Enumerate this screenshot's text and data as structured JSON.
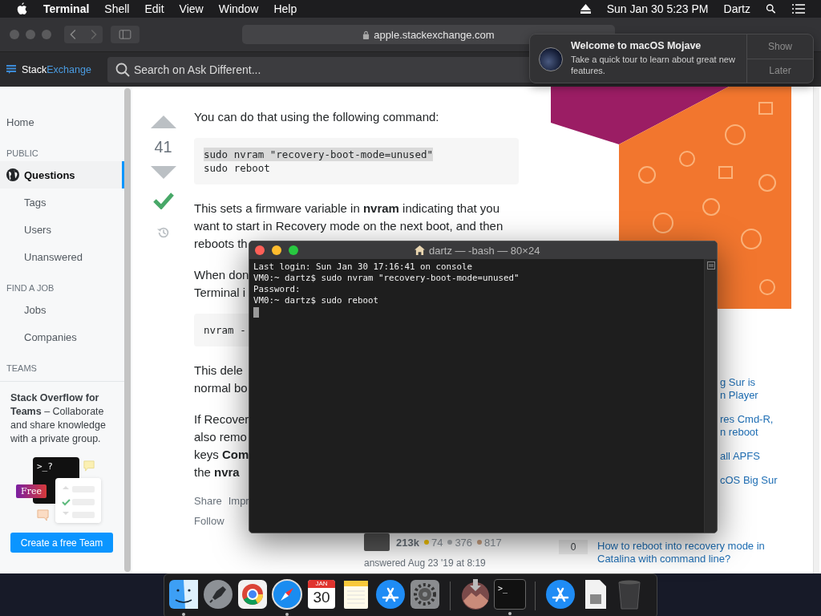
{
  "menu_bar": {
    "app": "Terminal",
    "menus": [
      "Shell",
      "Edit",
      "View",
      "Window",
      "Help"
    ],
    "clock": "Sun Jan 30  5:23 PM",
    "user": "Dartz"
  },
  "browser": {
    "url": "apple.stackexchange.com"
  },
  "site_header": {
    "logo": [
      "Stack",
      "Exchange"
    ],
    "search": {
      "placeholder": "Search on Ask Different..."
    }
  },
  "sidebar": {
    "items": [
      {
        "kind": "top",
        "label": "Home",
        "selected": false
      },
      {
        "kind": "section",
        "label": "PUBLIC"
      },
      {
        "kind": "top",
        "label": "Questions",
        "selected": true
      },
      {
        "kind": "sub",
        "label": "Tags",
        "selected": false
      },
      {
        "kind": "sub",
        "label": "Users",
        "selected": false
      },
      {
        "kind": "sub",
        "label": "Unanswered",
        "selected": false
      },
      {
        "kind": "section",
        "label": "FIND A JOB"
      },
      {
        "kind": "sub",
        "label": "Jobs",
        "selected": false
      },
      {
        "kind": "sub",
        "label": "Companies",
        "selected": false
      },
      {
        "kind": "section",
        "label": "TEAMS"
      }
    ],
    "teams": {
      "text": "**Stack Overflow for Teams** – Collaborate and share knowledge with a private group.",
      "prompt": ">_?",
      "badge": "Free",
      "button": "Create a free Team"
    }
  },
  "answer": {
    "votes": "41",
    "accepted": true,
    "blocks": [
      {
        "kind": "text",
        "lines": [
          "You can do that using the following command:"
        ]
      },
      {
        "kind": "code",
        "lines": [
          {
            "text": "sudo nvram \"recovery-boot-mode=unused\"",
            "selected": true
          },
          {
            "text": "sudo reboot",
            "selected": false
          }
        ]
      },
      {
        "kind": "text",
        "lines": [
          "This sets a firmware variable in **nvram** indicating that you",
          "want to start in Recovery mode on the next boot, and then",
          "reboots th"
        ]
      },
      {
        "kind": "text",
        "lines": [
          "When don",
          "Terminal i"
        ]
      },
      {
        "kind": "code",
        "lines": [
          {
            "text": "nvram -",
            "selected": false
          }
        ]
      },
      {
        "kind": "text",
        "lines": [
          "This dele",
          "normal bo"
        ]
      },
      {
        "kind": "text",
        "lines": [
          "If Recover",
          "also remo",
          "keys **Com**",
          "the **nvra**"
        ]
      }
    ],
    "actions": [
      "Share",
      "Impr"
    ],
    "follow": "Follow",
    "user": {
      "reputation": "213k",
      "gold": "74",
      "silver": "376",
      "bronze": "817"
    },
    "answered": "answered Aug 23 '19 at 8:19"
  },
  "related": [
    {
      "lines": [
        "g Sur is",
        "n Player"
      ]
    },
    {
      "lines": [
        "res Cmd-R,",
        "n reboot"
      ]
    },
    {
      "lines": [
        "all APFS"
      ]
    },
    {
      "lines": [
        "cOS Big Sur"
      ]
    },
    {
      "votes": "0",
      "lines": [
        "How to reboot into recovery mode in",
        "Catalina with command line?"
      ]
    }
  ],
  "terminal": {
    "title": "dartz — -bash — 80×24",
    "lines": [
      "Last login: Sun Jan 30 17:16:41 on console",
      "VM0:~ dartz$ sudo nvram \"recovery-boot-mode=unused\"",
      "Password:",
      "VM0:~ dartz$ sudo reboot"
    ]
  },
  "notification": {
    "title": "Welcome to macOS Mojave",
    "body": "Take a quick tour to learn about great new features.",
    "actions": [
      "Show",
      "Later"
    ]
  },
  "dock": [
    {
      "kind": "finder",
      "running": true
    },
    {
      "kind": "rocket",
      "running": false
    },
    {
      "kind": "ring",
      "running": false
    },
    {
      "kind": "compass",
      "running": true
    },
    {
      "kind": "calendar",
      "month": "JAN",
      "day": "30",
      "running": false
    },
    {
      "kind": "notes",
      "running": false
    },
    {
      "kind": "appstore",
      "running": false
    },
    {
      "kind": "gear",
      "running": false
    },
    {
      "kind": "separator"
    },
    {
      "kind": "installer",
      "running": false
    },
    {
      "kind": "terminal",
      "label": ">_",
      "running": true
    },
    {
      "kind": "separator"
    },
    {
      "kind": "appstore",
      "running": false
    },
    {
      "kind": "document",
      "running": false
    },
    {
      "kind": "trash",
      "running": false
    }
  ]
}
